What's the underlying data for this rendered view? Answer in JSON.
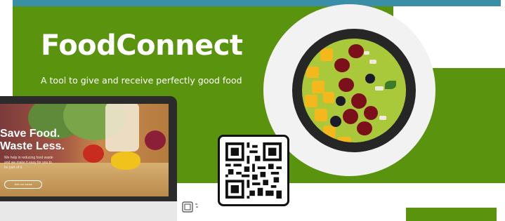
{
  "hero": {
    "title": "FoodConnect",
    "tagline": "A tool to give and receive perfectly good food"
  },
  "laptop": {
    "headline": "Save Food.\nWaste Less.",
    "body": "We help in reducing food waste\nand we make it easy for you to\nbe part of it.",
    "button": "Join our cause"
  },
  "colors": {
    "brand_green": "#5a930e",
    "top_bar": "#3a8fa6"
  },
  "icons": [
    "qr-code-icon",
    "scan-icon"
  ]
}
